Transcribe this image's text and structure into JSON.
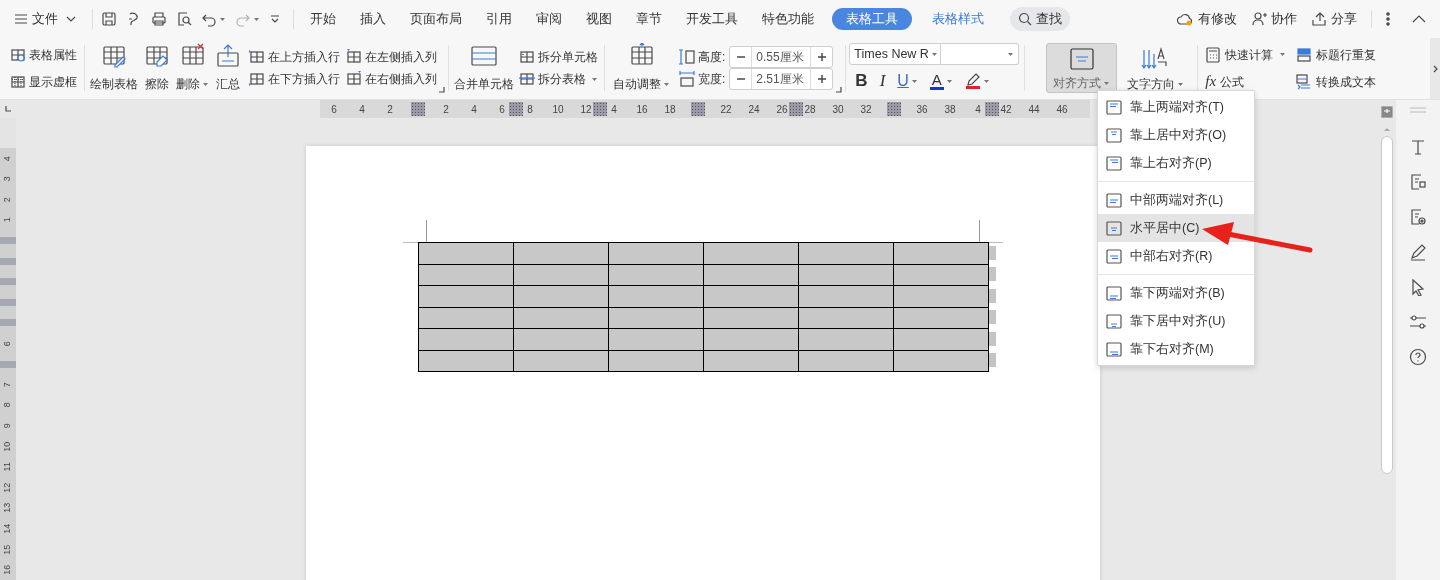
{
  "menu_bar": {
    "file_label": "文件",
    "tabs": [
      {
        "label": "开始",
        "selected": false,
        "kind": "main"
      },
      {
        "label": "插入",
        "selected": false,
        "kind": "main"
      },
      {
        "label": "页面布局",
        "selected": false,
        "kind": "main"
      },
      {
        "label": "引用",
        "selected": false,
        "kind": "main"
      },
      {
        "label": "审阅",
        "selected": false,
        "kind": "main"
      },
      {
        "label": "视图",
        "selected": false,
        "kind": "main"
      },
      {
        "label": "章节",
        "selected": false,
        "kind": "main"
      },
      {
        "label": "开发工具",
        "selected": false,
        "kind": "main"
      },
      {
        "label": "特色功能",
        "selected": false,
        "kind": "main"
      },
      {
        "label": "表格工具",
        "selected": true,
        "kind": "context"
      },
      {
        "label": "表格样式",
        "selected": false,
        "kind": "context"
      }
    ],
    "search_label": "查找",
    "actions": [
      "有修改",
      "协作",
      "分享"
    ]
  },
  "ribbon": {
    "table_options": [
      "表格属性",
      "显示虚框"
    ],
    "edit_buttons": [
      {
        "label": "绘制表格",
        "has_menu": false
      },
      {
        "label": "擦除",
        "has_menu": false
      },
      {
        "label": "删除",
        "has_menu": true
      },
      {
        "label": "汇总",
        "has_menu": false
      }
    ],
    "insert_buttons": [
      "在上方插入行",
      "在下方插入行",
      "在左侧插入列",
      "在右侧插入列"
    ],
    "merge_button": {
      "label": "合并单元格"
    },
    "split_buttons": [
      {
        "label": "拆分单元格",
        "has_menu": false
      },
      {
        "label": "拆分表格",
        "has_menu": true
      }
    ],
    "autofit_button": {
      "label": "自动调整",
      "has_menu": true
    },
    "size_fields": [
      {
        "label": "高度:",
        "value": "0.55厘米"
      },
      {
        "label": "宽度:",
        "value": "2.51厘米"
      }
    ],
    "font_family": "Times New R",
    "format_buttons": [
      {
        "kind": "bold",
        "label": "B",
        "has_menu": false
      },
      {
        "kind": "italic",
        "label": "I",
        "has_menu": false
      },
      {
        "kind": "underline",
        "label": "U",
        "has_menu": true
      },
      {
        "kind": "font_color",
        "label": "A",
        "has_menu": true,
        "color": "#1a33c8"
      },
      {
        "kind": "highlight",
        "has_menu": true,
        "color": "#e02424"
      }
    ],
    "align_buttons": [
      {
        "label": "对齐方式",
        "has_menu": true,
        "pressed": true
      },
      {
        "label": "文字方向",
        "has_menu": true,
        "pressed": false
      }
    ],
    "calc_buttons": [
      {
        "label": "快速计算",
        "has_menu": true
      },
      {
        "label": "标题行重复",
        "has_menu": false
      },
      {
        "label": "公式",
        "prefix": "fx",
        "has_menu": false
      },
      {
        "label": "转换成文本",
        "has_menu": false
      }
    ]
  },
  "horizontal_ruler": [
    {
      "kind": "number",
      "label": "6"
    },
    {
      "kind": "number",
      "label": "4"
    },
    {
      "kind": "number",
      "label": "2"
    },
    {
      "kind": "marker"
    },
    {
      "kind": "number",
      "label": "2"
    },
    {
      "kind": "number",
      "label": "4"
    },
    {
      "kind": "number",
      "label": "6"
    },
    {
      "kind": "inline_marker"
    },
    {
      "kind": "number",
      "label": "8"
    },
    {
      "kind": "number",
      "label": "10"
    },
    {
      "kind": "number",
      "label": "12"
    },
    {
      "kind": "inline_marker"
    },
    {
      "kind": "number",
      "label": "4"
    },
    {
      "kind": "number",
      "label": "16"
    },
    {
      "kind": "number",
      "label": "18"
    },
    {
      "kind": "marker"
    },
    {
      "kind": "number",
      "label": "22"
    },
    {
      "kind": "number",
      "label": "24"
    },
    {
      "kind": "number",
      "label": "26"
    },
    {
      "kind": "inline_marker"
    },
    {
      "kind": "number",
      "label": "28"
    },
    {
      "kind": "number",
      "label": "30"
    },
    {
      "kind": "number",
      "label": "32"
    },
    {
      "kind": "marker"
    },
    {
      "kind": "number",
      "label": "36"
    },
    {
      "kind": "number",
      "label": "38"
    },
    {
      "kind": "number",
      "label": "4"
    },
    {
      "kind": "inline_marker"
    },
    {
      "kind": "number",
      "label": "42"
    },
    {
      "kind": "number",
      "label": "44"
    },
    {
      "kind": "number",
      "label": "46"
    }
  ],
  "vertical_ruler": [
    {
      "kind": "number",
      "label": "4"
    },
    {
      "kind": "number",
      "label": "3"
    },
    {
      "kind": "number",
      "label": "2"
    },
    {
      "kind": "number",
      "label": "1"
    },
    {
      "kind": "marker"
    },
    {
      "kind": "marker"
    },
    {
      "kind": "marker"
    },
    {
      "kind": "marker"
    },
    {
      "kind": "marker"
    },
    {
      "kind": "number",
      "label": "6"
    },
    {
      "kind": "marker"
    },
    {
      "kind": "number",
      "label": "7"
    },
    {
      "kind": "number",
      "label": "8"
    },
    {
      "kind": "number",
      "label": "9"
    },
    {
      "kind": "number",
      "label": "10"
    },
    {
      "kind": "number",
      "label": "11"
    },
    {
      "kind": "number",
      "label": "12"
    },
    {
      "kind": "number",
      "label": "13"
    },
    {
      "kind": "number",
      "label": "14"
    },
    {
      "kind": "number",
      "label": "15"
    },
    {
      "kind": "number",
      "label": "16"
    }
  ],
  "table": {
    "rows": [
      {
        "cells": [
          {
            "shaded": true
          },
          {
            "shaded": true
          },
          {
            "shaded": true
          },
          {
            "shaded": true
          },
          {
            "shaded": true
          },
          {
            "shaded": true
          }
        ]
      },
      {
        "cells": [
          {
            "shaded": true
          },
          {
            "shaded": true
          },
          {
            "shaded": true
          },
          {
            "shaded": true
          },
          {
            "shaded": true
          },
          {
            "shaded": true
          }
        ]
      },
      {
        "cells": [
          {
            "shaded": true
          },
          {
            "shaded": true
          },
          {
            "shaded": true
          },
          {
            "shaded": true
          },
          {
            "shaded": true
          },
          {
            "shaded": true
          }
        ]
      },
      {
        "cells": [
          {
            "shaded": true
          },
          {
            "shaded": true
          },
          {
            "shaded": true
          },
          {
            "shaded": true
          },
          {
            "shaded": true
          },
          {
            "shaded": true
          }
        ]
      },
      {
        "cells": [
          {
            "shaded": true
          },
          {
            "shaded": true
          },
          {
            "shaded": true
          },
          {
            "shaded": true
          },
          {
            "shaded": true
          },
          {
            "shaded": true
          }
        ]
      },
      {
        "cells": [
          {
            "shaded": true
          },
          {
            "shaded": true
          },
          {
            "shaded": true
          },
          {
            "shaded": true
          },
          {
            "shaded": true
          },
          {
            "shaded": true
          }
        ]
      }
    ]
  },
  "align_menu": {
    "groups": [
      {
        "items": [
          {
            "label": "靠上两端对齐(T)",
            "selected": false
          },
          {
            "label": "靠上居中对齐(O)",
            "selected": false
          },
          {
            "label": "靠上右对齐(P)",
            "selected": false
          }
        ]
      },
      {
        "items": [
          {
            "label": "中部两端对齐(L)",
            "selected": false
          },
          {
            "label": "水平居中(C)",
            "selected": true
          },
          {
            "label": "中部右对齐(R)",
            "selected": false
          }
        ]
      },
      {
        "items": [
          {
            "label": "靠下两端对齐(B)",
            "selected": false
          },
          {
            "label": "靠下居中对齐(U)",
            "selected": false
          },
          {
            "label": "靠下右对齐(M)",
            "selected": false
          }
        ]
      }
    ]
  }
}
